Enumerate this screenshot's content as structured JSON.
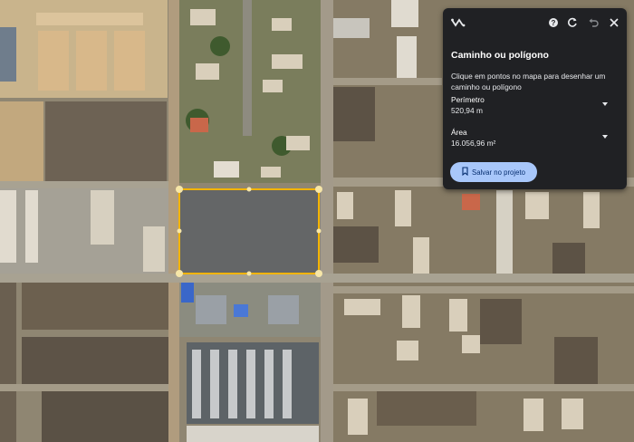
{
  "panel": {
    "title": "Caminho ou polígono",
    "instruction": "Clique em pontos no mapa para desenhar um caminho ou polígono",
    "measurements": [
      {
        "label": "Perímetro",
        "value": "520,94 m"
      },
      {
        "label": "Área",
        "value": "16.056,96 m²"
      }
    ],
    "save_label": "Salvar no projeto",
    "toolbar_icons": [
      "path-logo-icon",
      "help-icon",
      "refresh-icon",
      "undo-icon",
      "close-icon"
    ]
  },
  "colors": {
    "panel_bg": "#202124",
    "polygon_stroke": "#f4b400",
    "save_button_bg": "#a8c7fa",
    "save_button_text": "#062e6f"
  }
}
